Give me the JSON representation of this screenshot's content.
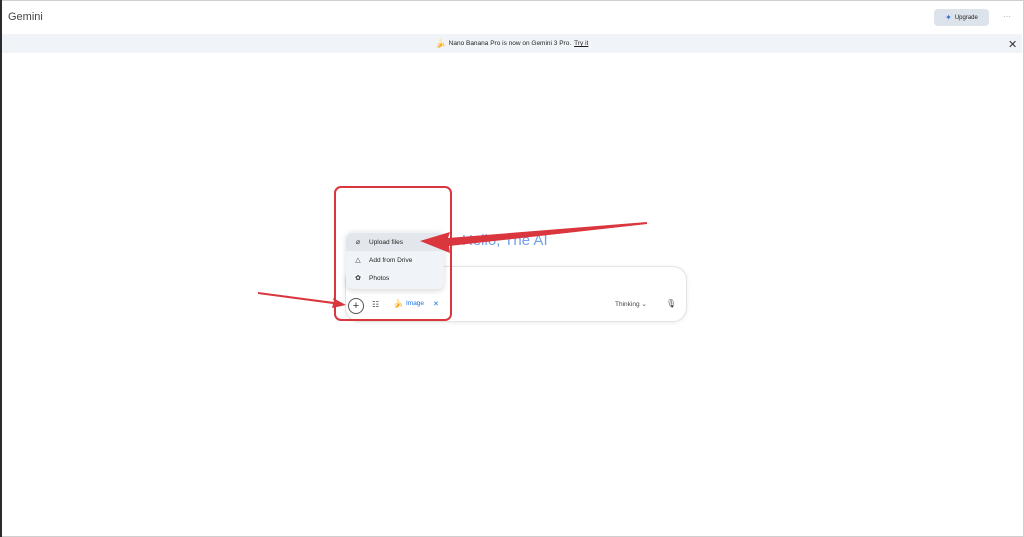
{
  "header": {
    "app_title": "Gemini",
    "upgrade_label": "Upgrade",
    "upgrade_icon": "sparkle-icon"
  },
  "banner": {
    "text": "Nano Banana Pro is now on Gemini 3 Pro.",
    "link": "Try it",
    "icon": "banana-icon",
    "close_icon": "close-icon"
  },
  "main": {
    "greeting": "Hello, The AI"
  },
  "menu": {
    "items": [
      {
        "label": "Upload files",
        "icon": "paperclip-icon"
      },
      {
        "label": "Add from Drive",
        "icon": "drive-icon"
      },
      {
        "label": "Photos",
        "icon": "photos-icon"
      }
    ]
  },
  "composer": {
    "tool_chip": "Image",
    "model_label": "Thinking",
    "icons": [
      "plus-icon",
      "tools-icon",
      "mic-icon"
    ]
  },
  "annotations": {
    "color": "#d9363e"
  }
}
